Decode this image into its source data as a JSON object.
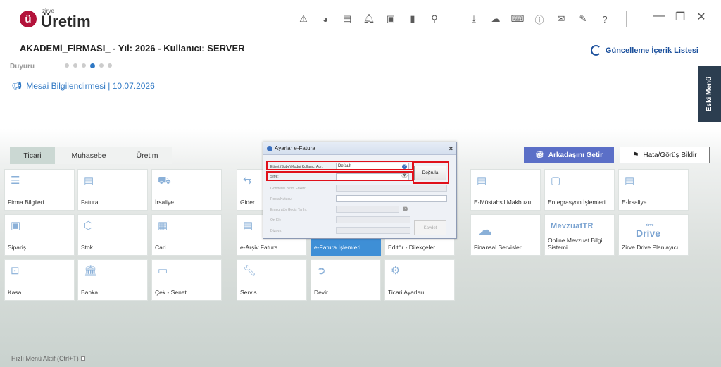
{
  "app": {
    "logo_small": "zirve",
    "logo_big": "Üretim"
  },
  "header": {
    "company_line": "AKADEMİ_FİRMASI_ - Yıl: 2026 - Kullanıcı: SERVER",
    "update_link": "Güncelleme İçerik Listesi"
  },
  "toolbar_icons": [
    "warning-icon",
    "pie-icon",
    "news-icon",
    "bell-icon",
    "money-icon",
    "book-icon",
    "location-icon",
    "download-icon",
    "cloud-icon",
    "keyboard-icon",
    "info-icon",
    "chat-icon",
    "edit-icon",
    "help-icon"
  ],
  "duyuru": {
    "label": "Duyuru"
  },
  "notice": {
    "text": "Mesai Bilgilendirmesi | 10.07.2026"
  },
  "side": {
    "old_menu": "Eski Menü"
  },
  "tabs": [
    {
      "label": "Ticari"
    },
    {
      "label": "Muhasebe"
    },
    {
      "label": "Üretim"
    }
  ],
  "buttons": {
    "refer": "Arkadaşını Getir",
    "report": "Hata/Görüş Bildir"
  },
  "tiles": {
    "firma": "Firma Bilgileri",
    "fatura": "Fatura",
    "irsaliye": "İrsaliye",
    "gider": "Gider",
    "siparis": "Sipariş",
    "stok": "Stok",
    "cari": "Cari",
    "earsiv": "e-Arşiv Fatura",
    "efatura": "e-Fatura İşlemleri",
    "editor": "Editör - Dilekçeler",
    "kasa": "Kasa",
    "banka": "Banka",
    "cek": "Çek - Senet",
    "servis": "Servis",
    "devir": "Devir",
    "ticari_ayar": "Ticari Ayarları",
    "emustahsil": "E-Müstahsil Makbuzu",
    "entegrasyon": "Entegrasyon İşlemleri",
    "eirsaliye": "E-İrsaliye",
    "finansal": "Finansal Servisler",
    "mevzuat": "Online Mevzuat Bilgi Sistemi",
    "drive": "Zirve Drive Planlayıcı",
    "mevzuat_brand": "MevzuatTR",
    "drive_brand": "Drive",
    "drive_brand_small": "zirve"
  },
  "dialog": {
    "title": "Ayarlar e-Fatura",
    "close": "×",
    "label_user": "Etiket (Şube) Kodu/ Kullanıcı Adı :",
    "value_user": "Default",
    "label_pass": "Şifre:",
    "label_gonderici": "Gönderici Birim Etiketi:",
    "label_posta": "Posta Kutusu:",
    "label_gecis": "Entegratör Geçiş Tarihi:",
    "label_onek": "Ön Ek:",
    "label_dizayn": "Dizayn:",
    "btn_verify": "Doğrula",
    "btn_save": "Kaydet"
  },
  "footer": {
    "quick_menu": "Hızlı Menü Aktif (Ctrl+T)"
  }
}
